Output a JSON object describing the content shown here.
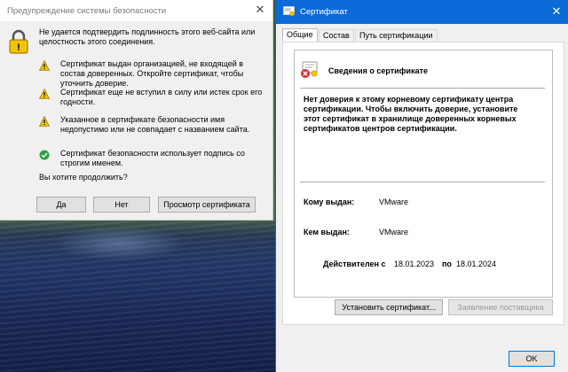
{
  "warning_dialog": {
    "title": "Предупреждение системы безопасности",
    "lead": "Не удается подтвердить подлинность этого веб-сайта или целостность этого соединения.",
    "items": [
      {
        "type": "warning",
        "text": "Сертификат выдан организацией, не входящей в состав доверенных. Откройте сертификат, чтобы уточнить доверие."
      },
      {
        "type": "warning",
        "text": "Сертификат еще не вступил в силу или истек срок его годности."
      },
      {
        "type": "warning",
        "text": "Указанное в сертификате безопасности имя недопустимо или не совпадает с названием сайта."
      },
      {
        "type": "ok",
        "text": "Сертификат безопасности использует подпись со строгим именем."
      }
    ],
    "question": "Вы хотите продолжить?",
    "buttons": {
      "yes": "Да",
      "no": "Нет",
      "view_certificate": "Просмотр сертификата"
    }
  },
  "certificate_window": {
    "title": "Сертификат",
    "tabs": [
      "Общие",
      "Состав",
      "Путь сертификации"
    ],
    "header": "Сведения о сертификате",
    "message": "Нет доверия к этому корневому сертификату центра сертификации. Чтобы включить доверие, установите этот сертификат в хранилище доверенных корневых сертификатов центров сертификации.",
    "issued_to_label": "Кому выдан:",
    "issued_to": "VMware",
    "issued_by_label": "Кем выдан:",
    "issued_by": "VMware",
    "valid_from_label": "Действителен с",
    "valid_from": "18.01.2023",
    "valid_to_label": "по",
    "valid_to": "18.01.2024",
    "buttons": {
      "install": "Установить сертификат...",
      "issuer_statement": "Заявление поставщика",
      "ok": "OK"
    }
  },
  "colors": {
    "titlebar_accent": "#0b6ad8",
    "warning": "#f3c400",
    "ok": "#2ea043",
    "error": "#d32f2f"
  }
}
